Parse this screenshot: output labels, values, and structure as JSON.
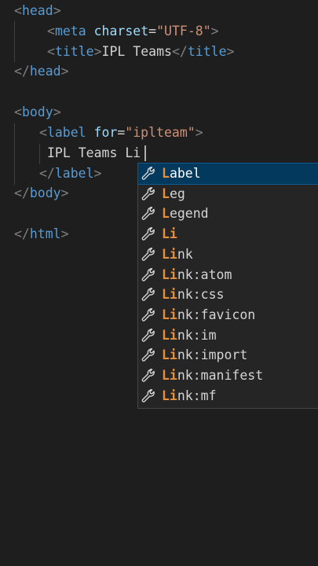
{
  "editor": {
    "lines": [
      {
        "parts": [
          {
            "t": "<",
            "c": "bracket"
          },
          {
            "t": "head",
            "c": "tag"
          },
          {
            "t": ">",
            "c": "bracket"
          }
        ]
      },
      {
        "parts": [
          {
            "t": "<",
            "c": "bracket"
          },
          {
            "t": "meta",
            "c": "tag"
          },
          {
            "t": " ",
            "c": "txt"
          },
          {
            "t": "charset",
            "c": "attr"
          },
          {
            "t": "=",
            "c": "txt"
          },
          {
            "t": "\"UTF-8\"",
            "c": "str"
          },
          {
            "t": ">",
            "c": "bracket"
          }
        ]
      },
      {
        "parts": [
          {
            "t": "<",
            "c": "bracket"
          },
          {
            "t": "title",
            "c": "tag"
          },
          {
            "t": ">",
            "c": "bracket"
          },
          {
            "t": "IPL Teams",
            "c": "txt"
          },
          {
            "t": "</",
            "c": "bracket"
          },
          {
            "t": "title",
            "c": "tag"
          },
          {
            "t": ">",
            "c": "bracket"
          }
        ]
      },
      {
        "parts": [
          {
            "t": "</",
            "c": "bracket"
          },
          {
            "t": "head",
            "c": "tag"
          },
          {
            "t": ">",
            "c": "bracket"
          }
        ]
      },
      {
        "parts": []
      },
      {
        "parts": [
          {
            "t": "<",
            "c": "bracket"
          },
          {
            "t": "body",
            "c": "tag"
          },
          {
            "t": ">",
            "c": "bracket"
          }
        ]
      },
      {
        "parts": [
          {
            "t": "<",
            "c": "bracket"
          },
          {
            "t": "label",
            "c": "tag"
          },
          {
            "t": " ",
            "c": "txt"
          },
          {
            "t": "for",
            "c": "attr"
          },
          {
            "t": "=",
            "c": "txt"
          },
          {
            "t": "\"iplteam\"",
            "c": "str"
          },
          {
            "t": ">",
            "c": "bracket"
          }
        ]
      },
      {
        "parts": [
          {
            "t": "IPL Teams Li",
            "c": "txt"
          }
        ]
      },
      {
        "parts": [
          {
            "t": "</",
            "c": "bracket"
          },
          {
            "t": "label",
            "c": "tag"
          },
          {
            "t": ">",
            "c": "bracket"
          }
        ]
      },
      {
        "parts": [
          {
            "t": "</",
            "c": "bracket"
          },
          {
            "t": "body",
            "c": "tag"
          },
          {
            "t": ">",
            "c": "bracket"
          }
        ]
      },
      {
        "parts": []
      },
      {
        "parts": [
          {
            "t": "</",
            "c": "bracket"
          },
          {
            "t": "html",
            "c": "tag"
          },
          {
            "t": ">",
            "c": "bracket"
          }
        ]
      }
    ]
  },
  "suggest": {
    "icon": "wrench-icon",
    "items": [
      {
        "match": "L",
        "rest": "abel"
      },
      {
        "match": "L",
        "rest": "eg"
      },
      {
        "match": "L",
        "rest": "egend"
      },
      {
        "match": "Li",
        "rest": ""
      },
      {
        "match": "Li",
        "rest": "nk"
      },
      {
        "match": "Li",
        "rest": "nk:atom"
      },
      {
        "match": "Li",
        "rest": "nk:css"
      },
      {
        "match": "Li",
        "rest": "nk:favicon"
      },
      {
        "match": "Li",
        "rest": "nk:im"
      },
      {
        "match": "Li",
        "rest": "nk:import"
      },
      {
        "match": "Li",
        "rest": "nk:manifest"
      },
      {
        "match": "Li",
        "rest": "nk:mf"
      }
    ]
  },
  "colors": {
    "background": "#1e1e1e",
    "tag": "#569cd6",
    "attribute": "#9cdcfe",
    "string": "#ce9178",
    "match_highlight": "#e58e3c",
    "selection": "#04395e"
  }
}
